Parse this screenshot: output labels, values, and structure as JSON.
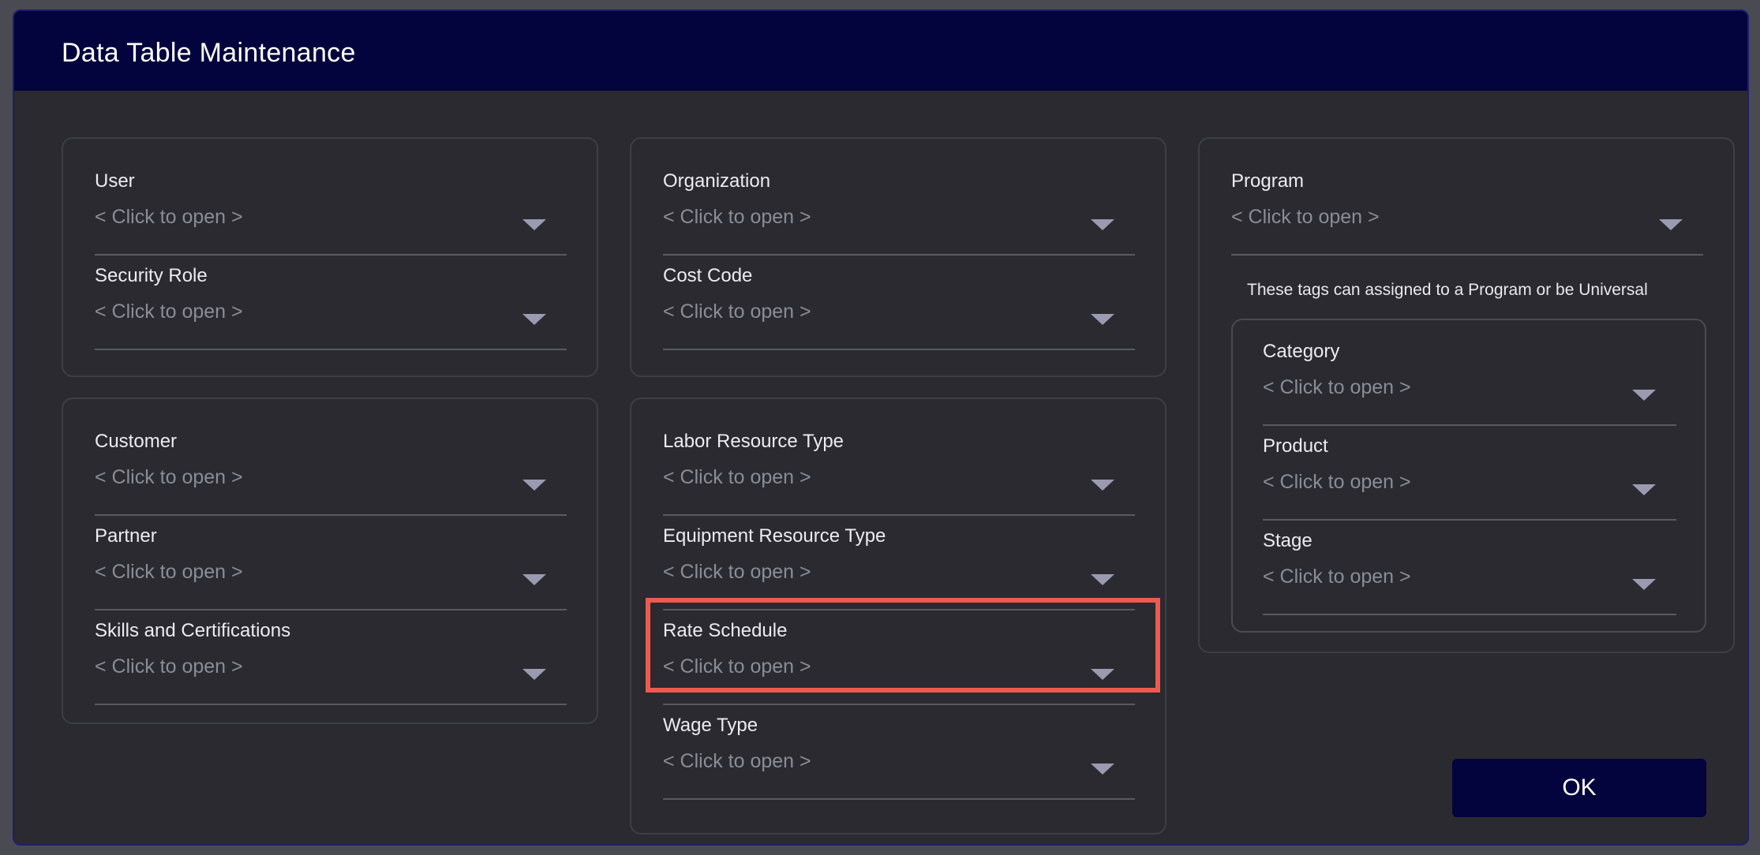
{
  "dialog": {
    "title": "Data Table Maintenance"
  },
  "placeholder": "< Click to open >",
  "panels": {
    "left_top": [
      {
        "label": "User",
        "value": "< Click to open >"
      },
      {
        "label": "Security Role",
        "value": "< Click to open >"
      }
    ],
    "left_bottom": [
      {
        "label": "Customer",
        "value": "< Click to open >"
      },
      {
        "label": "Partner",
        "value": "< Click to open >"
      },
      {
        "label": "Skills and Certifications",
        "value": "< Click to open >"
      }
    ],
    "mid_top": [
      {
        "label": "Organization",
        "value": "< Click to open >"
      },
      {
        "label": "Cost Code",
        "value": "< Click to open >"
      }
    ],
    "mid_bottom": [
      {
        "label": "Labor Resource Type",
        "value": "< Click to open >"
      },
      {
        "label": "Equipment Resource Type",
        "value": "< Click to open >"
      },
      {
        "label": "Rate Schedule",
        "value": "< Click to open >"
      },
      {
        "label": "Wage Type",
        "value": "< Click to open >"
      }
    ],
    "right": {
      "program": {
        "label": "Program",
        "value": "< Click to open >"
      },
      "tags_note": "These tags can assigned to a Program or be Universal",
      "tags": [
        {
          "label": "Category",
          "value": "< Click to open >"
        },
        {
          "label": "Product",
          "value": "< Click to open >"
        },
        {
          "label": "Stage",
          "value": "< Click to open >"
        }
      ]
    }
  },
  "ok_button": {
    "label": "OK"
  },
  "colors": {
    "title_bar": "#03033e",
    "dialog_bg": "#2a2a30",
    "highlight": "#ef5a4e",
    "placeholder_text": "#8c8c98"
  }
}
